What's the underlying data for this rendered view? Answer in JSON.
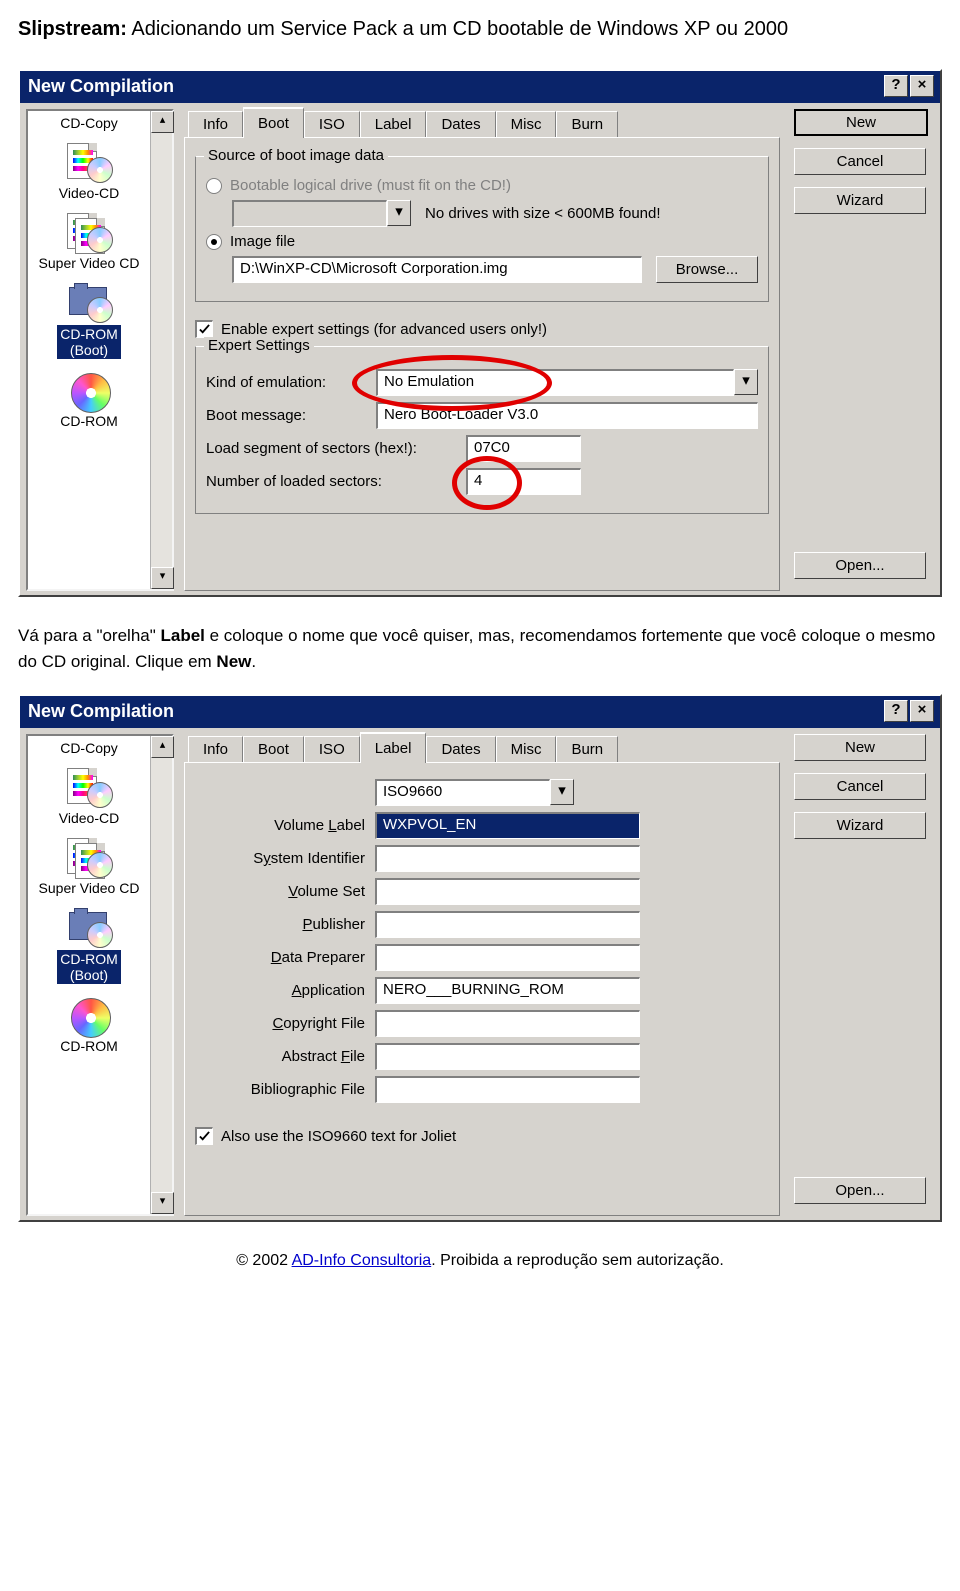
{
  "page": {
    "title_bold": "Slipstream:",
    "title_rest": " Adicionando um Service Pack a um CD bootable de Windows XP ou 2000"
  },
  "body_text": {
    "p1_a": "Vá para a \"orelha\" ",
    "p1_b": "Label",
    "p1_c": " e coloque o nome que você quiser, mas, recomendamos fortemente que você coloque o mesmo do CD original. Clique em ",
    "p1_d": "New",
    "p1_e": "."
  },
  "common": {
    "window_title": "New Compilation",
    "help_btn": "?",
    "close_btn": "×",
    "sidebar": {
      "items": [
        {
          "label": "CD-Copy"
        },
        {
          "label": "Video-CD"
        },
        {
          "label": "Super Video CD"
        },
        {
          "label": "CD-ROM (Boot)",
          "selected": true
        },
        {
          "label": "CD-ROM"
        }
      ],
      "scroll_up": "▴",
      "scroll_down": "▾"
    },
    "tabs": [
      "Info",
      "Boot",
      "ISO",
      "Label",
      "Dates",
      "Misc",
      "Burn"
    ],
    "right_buttons": {
      "new": "New",
      "cancel": "Cancel",
      "wizard": "Wizard",
      "open": "Open..."
    }
  },
  "boot_tab": {
    "group_source": "Source of boot image data",
    "radio_drive": "Bootable logical drive (must fit on the CD!)",
    "no_drives": "No drives with size < 600MB found!",
    "radio_image": "Image file",
    "image_path": "D:\\WinXP-CD\\Microsoft Corporation.img",
    "browse": "Browse...",
    "enable_expert": "Enable expert settings (for advanced users only!)",
    "group_expert": "Expert Settings",
    "kind_label": "Kind of emulation:",
    "kind_value": "No Emulation",
    "boot_msg_label": "Boot message:",
    "boot_msg_value": "Nero Boot-Loader V3.0",
    "load_seg_label": "Load segment of sectors (hex!):",
    "load_seg_value": "07C0",
    "num_sect_label": "Number of loaded sectors:",
    "num_sect_value": "4"
  },
  "label_tab": {
    "type_value": "ISO9660",
    "rows": {
      "volume_label": {
        "lbl": "Volume Label",
        "ul": "L",
        "val": "WXPVOL_EN",
        "sel": true
      },
      "system_id": {
        "lbl": "System Identifier",
        "ul": "y",
        "val": ""
      },
      "volume_set": {
        "lbl": "Volume Set",
        "ul": "V",
        "val": ""
      },
      "publisher": {
        "lbl": "Publisher",
        "ul": "P",
        "val": ""
      },
      "data_prep": {
        "lbl": "Data Preparer",
        "ul": "D",
        "val": ""
      },
      "application": {
        "lbl": "Application",
        "ul": "A",
        "val": "NERO___BURNING_ROM"
      },
      "copyright": {
        "lbl": "Copyright File",
        "ul": "C",
        "val": ""
      },
      "abstract": {
        "lbl": "Abstract File",
        "ul": "F",
        "val": ""
      },
      "biblio": {
        "lbl": "Bibliographic File",
        "val": ""
      }
    },
    "also_joliet": "Also use the ISO9660 text for Joliet"
  },
  "footer": {
    "copyright": "© 2002 ",
    "link": "AD-Info Consultoria",
    "rest": ". Proibida a reprodução sem autorização."
  }
}
